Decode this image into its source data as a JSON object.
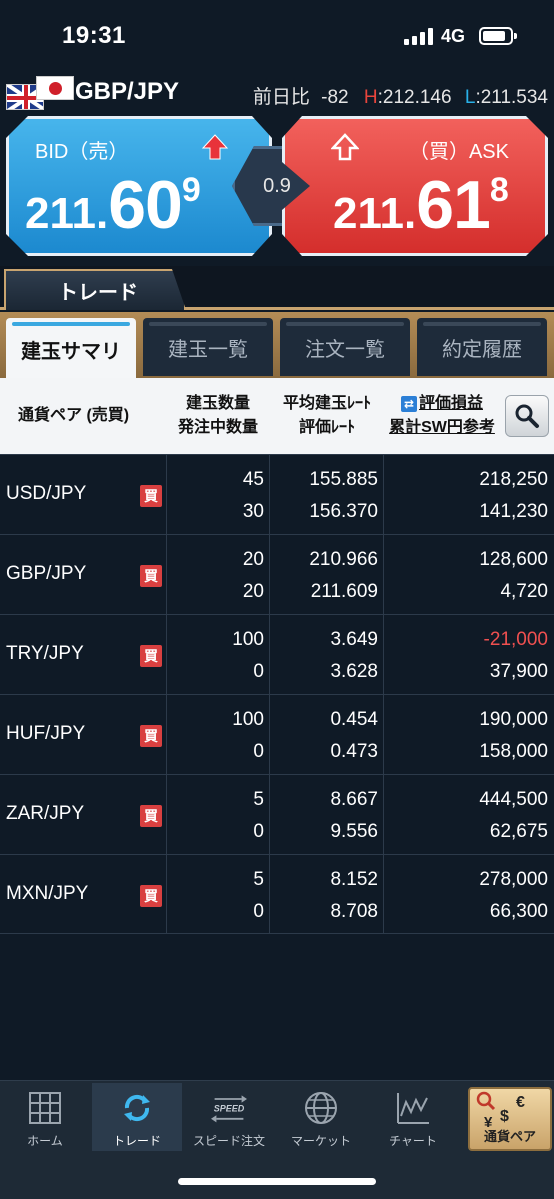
{
  "status_bar": {
    "time": "19:31",
    "network": "4G"
  },
  "header": {
    "pair": "GBP/JPY",
    "change_label": "前日比",
    "change_value": "-82",
    "high_label": "H",
    "high_value": "212.146",
    "low_label": "L",
    "low_value": "211.534"
  },
  "bid": {
    "label": "BID（売）",
    "main": "211.",
    "big": "60",
    "sup": "9"
  },
  "ask": {
    "label": "（買）ASK",
    "main": "211.",
    "big": "61",
    "sup": "8"
  },
  "spread": "0.9",
  "trade_tab": "トレード",
  "sub_tabs": [
    "建玉サマリ",
    "建玉一覧",
    "注文一覧",
    "約定履歴"
  ],
  "table_header": {
    "pair": "通貨ペア (売買)",
    "qty_top": "建玉数量",
    "qty_bottom": "発注中数量",
    "rate_top": "平均建玉ﾚｰﾄ",
    "rate_bottom": "評価ﾚｰﾄ",
    "pl_top": "評価損益",
    "pl_bottom": "累計SW円参考"
  },
  "rows": [
    {
      "pair": "USD/JPY",
      "side": "買",
      "qty": "45",
      "pending": "30",
      "avg_rate": "155.885",
      "eval_rate": "156.370",
      "pl": "218,250",
      "sw": "141,230",
      "pl_negative": false
    },
    {
      "pair": "GBP/JPY",
      "side": "買",
      "qty": "20",
      "pending": "20",
      "avg_rate": "210.966",
      "eval_rate": "211.609",
      "pl": "128,600",
      "sw": "4,720",
      "pl_negative": false
    },
    {
      "pair": "TRY/JPY",
      "side": "買",
      "qty": "100",
      "pending": "0",
      "avg_rate": "3.649",
      "eval_rate": "3.628",
      "pl": "-21,000",
      "sw": "37,900",
      "pl_negative": true
    },
    {
      "pair": "HUF/JPY",
      "side": "買",
      "qty": "100",
      "pending": "0",
      "avg_rate": "0.454",
      "eval_rate": "0.473",
      "pl": "190,000",
      "sw": "158,000",
      "pl_negative": false
    },
    {
      "pair": "ZAR/JPY",
      "side": "買",
      "qty": "5",
      "pending": "0",
      "avg_rate": "8.667",
      "eval_rate": "9.556",
      "pl": "444,500",
      "sw": "62,675",
      "pl_negative": false
    },
    {
      "pair": "MXN/JPY",
      "side": "買",
      "qty": "5",
      "pending": "0",
      "avg_rate": "8.152",
      "eval_rate": "8.708",
      "pl": "278,000",
      "sw": "66,300",
      "pl_negative": false
    }
  ],
  "bottom_nav": [
    {
      "label": "ホーム",
      "icon": "grid-icon"
    },
    {
      "label": "トレード",
      "icon": "refresh-icon",
      "active": true
    },
    {
      "label": "スピード注文",
      "icon": "speed-icon",
      "icon_text": "SPEED"
    },
    {
      "label": "マーケット",
      "icon": "globe-icon"
    },
    {
      "label": "チャート",
      "icon": "chart-icon"
    },
    {
      "label": "通貨ペア",
      "icon": "currency-icon",
      "symbols": [
        "€",
        "¥",
        "$"
      ]
    }
  ],
  "colors": {
    "bid": "#1c89cf",
    "ask": "#d42e2c",
    "negative": "#f05050",
    "accent_gold": "#c8a470"
  }
}
